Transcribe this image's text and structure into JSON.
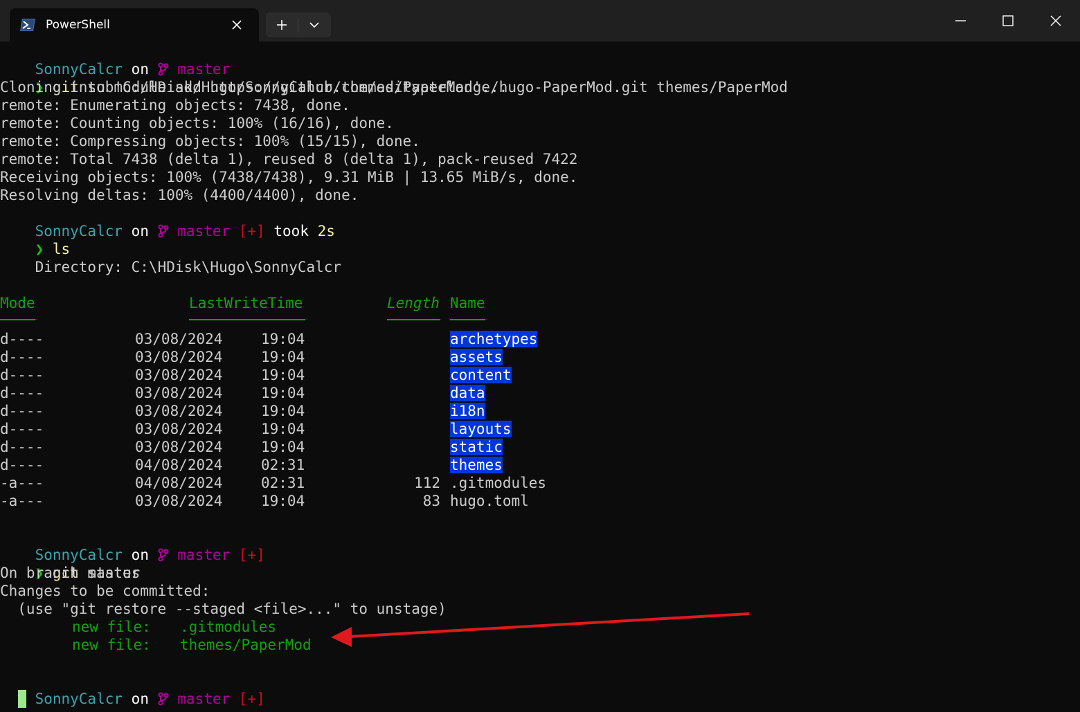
{
  "window": {
    "tab_title": "PowerShell",
    "icons": {
      "tab": "powershell-icon",
      "close": "close-icon",
      "new_tab": "plus-icon",
      "dropdown": "chevron-down-icon",
      "minimize": "minimize-icon",
      "maximize": "maximize-icon",
      "window_close": "window-close-icon"
    }
  },
  "prompt": {
    "user": "SonnyCalcr",
    "on": "on",
    "branch_icon": "git-branch-icon",
    "branch": "master",
    "dirty": "[+]",
    "took": "took",
    "duration": "2s",
    "chevron": "❯"
  },
  "cmd1": {
    "command": "git",
    "args": "submodule add https://github.com/adityatelange/hugo-PaperMod.git themes/PaperMod"
  },
  "clone_output": [
    "Cloning into 'C:/HDisk/Hugo/SonnyCalcr/themes/PaperMod'...",
    "remote: Enumerating objects: 7438, done.",
    "remote: Counting objects: 100% (16/16), done.",
    "remote: Compressing objects: 100% (15/15), done.",
    "remote: Total 7438 (delta 1), reused 8 (delta 1), pack-reused 7422",
    "Receiving objects: 100% (7438/7438), 9.31 MiB | 13.65 MiB/s, done.",
    "Resolving deltas: 100% (4400/4400), done."
  ],
  "cmd2": {
    "command": "ls"
  },
  "directory_line": "    Directory: C:\\HDisk\\Hugo\\SonnyCalcr",
  "ls_headers": {
    "mode": "Mode",
    "time": "LastWriteTime",
    "length": "Length",
    "name": "Name"
  },
  "ls_rows": [
    {
      "mode": "d----",
      "date": "03/08/2024",
      "time": "19:04",
      "length": "",
      "name": "archetypes",
      "dir": true
    },
    {
      "mode": "d----",
      "date": "03/08/2024",
      "time": "19:04",
      "length": "",
      "name": "assets",
      "dir": true
    },
    {
      "mode": "d----",
      "date": "03/08/2024",
      "time": "19:04",
      "length": "",
      "name": "content",
      "dir": true
    },
    {
      "mode": "d----",
      "date": "03/08/2024",
      "time": "19:04",
      "length": "",
      "name": "data",
      "dir": true
    },
    {
      "mode": "d----",
      "date": "03/08/2024",
      "time": "19:04",
      "length": "",
      "name": "i18n",
      "dir": true
    },
    {
      "mode": "d----",
      "date": "03/08/2024",
      "time": "19:04",
      "length": "",
      "name": "layouts",
      "dir": true
    },
    {
      "mode": "d----",
      "date": "03/08/2024",
      "time": "19:04",
      "length": "",
      "name": "static",
      "dir": true
    },
    {
      "mode": "d----",
      "date": "04/08/2024",
      "time": "02:31",
      "length": "",
      "name": "themes",
      "dir": true
    },
    {
      "mode": "-a---",
      "date": "04/08/2024",
      "time": "02:31",
      "length": "112",
      "name": ".gitmodules",
      "dir": false
    },
    {
      "mode": "-a---",
      "date": "03/08/2024",
      "time": "19:04",
      "length": "83",
      "name": "hugo.toml",
      "dir": false
    }
  ],
  "cmd3": {
    "command": "git",
    "args": "status"
  },
  "status_output": {
    "branch_line": "On branch master",
    "changes_line": "Changes to be committed:",
    "hint_line": "  (use \"git restore --staged <file>...\" to unstage)",
    "new_files": [
      {
        "label": "new file:",
        "path": ".gitmodules"
      },
      {
        "label": "new file:",
        "path": "themes/PaperMod"
      }
    ]
  },
  "annotation": {
    "arrow_color": "#e0191e"
  },
  "colors": {
    "background": "#0c0c0c",
    "titlebar": "#202020",
    "user": "#3aa5b0",
    "branch": "#b4009e",
    "prompt_chevron": "#16c60c",
    "command": "#f9f1a5",
    "header": "#13a10e",
    "dir_highlight": "#0037da"
  }
}
